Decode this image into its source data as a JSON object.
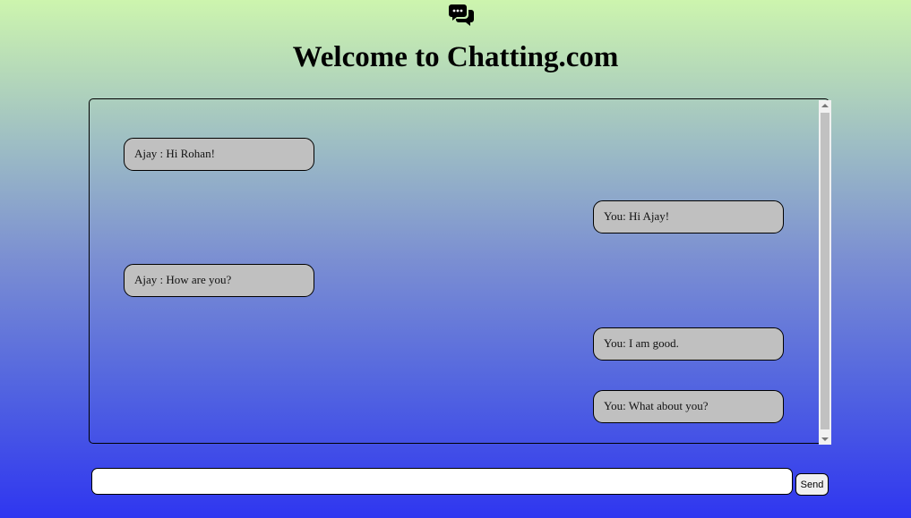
{
  "header": {
    "logo_icon": "chat-bubbles-icon",
    "title": "Welcome to Chatting.com"
  },
  "chat": {
    "messages": [
      {
        "side": "left",
        "text": "Ajay : Hi Rohan!"
      },
      {
        "side": "right",
        "text": "You: Hi Ajay!"
      },
      {
        "side": "left",
        "text": "Ajay : How are you?"
      },
      {
        "side": "right",
        "text": "You: I am good."
      },
      {
        "side": "right",
        "text": "You: What about you?"
      }
    ]
  },
  "composer": {
    "input_value": "",
    "send_label": "Send"
  },
  "colors": {
    "bubble_bg": "#c0c0c0",
    "gradient_top": "#cdf5ae",
    "gradient_bottom": "#2f36f0"
  }
}
